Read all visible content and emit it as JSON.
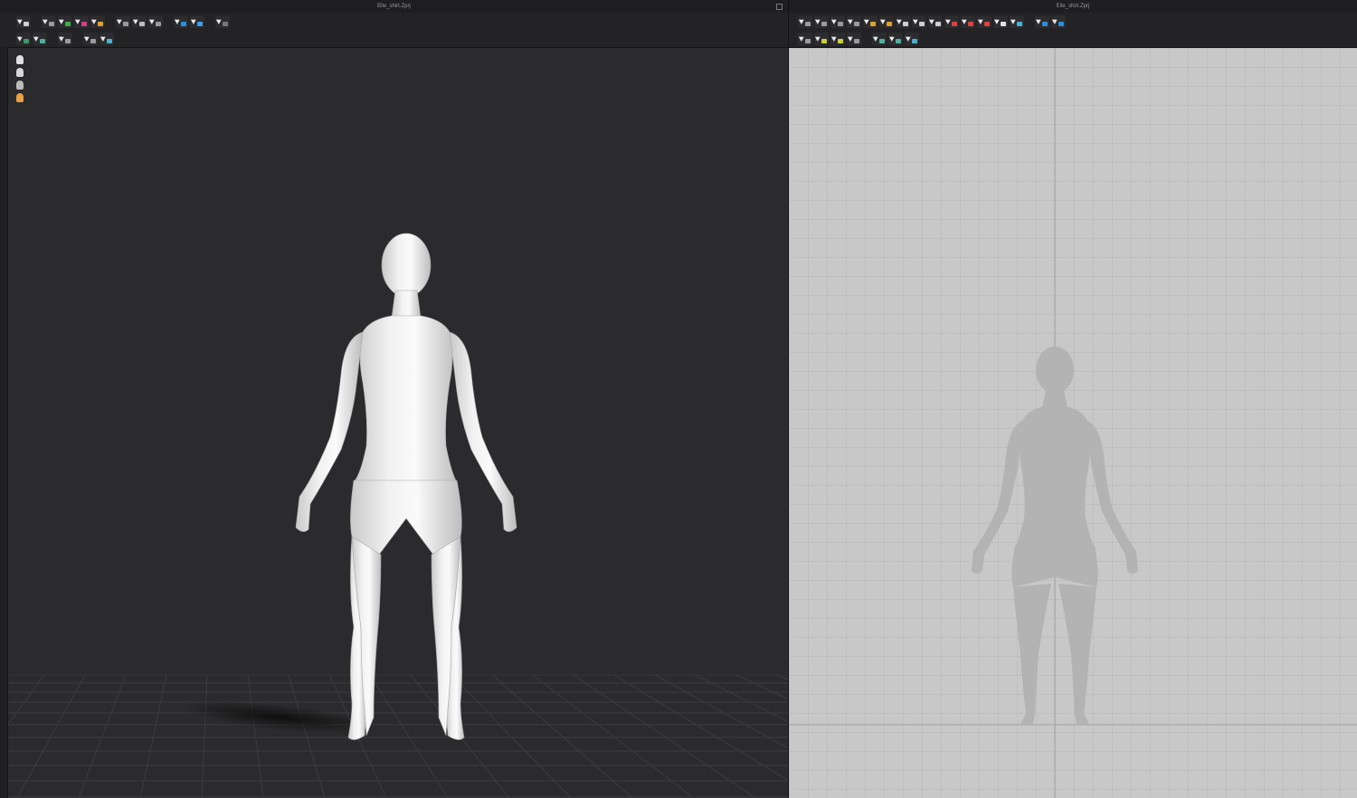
{
  "left_pane": {
    "title": "Elle_shirt.Zprj",
    "toolbar_row1": [
      {
        "icon": "arrow-down-icon",
        "color": "#cfcfcf"
      },
      {
        "icon": "select-tool-icon",
        "color": "#9a9a9a"
      },
      {
        "icon": "shirt-icon",
        "color": "#3fae4a"
      },
      {
        "icon": "shirt-icon",
        "color": "#d63a8a"
      },
      {
        "icon": "folder-icon",
        "color": "#e0a030"
      },
      {
        "icon": "pin-tool-icon",
        "color": "#9a9a9a"
      },
      {
        "icon": "fold-tool-icon",
        "color": "#bdbdbd"
      },
      {
        "icon": "avatar-tool-icon",
        "color": "#9a9a9a"
      },
      {
        "icon": "garment-blue-icon",
        "color": "#2a8de0"
      },
      {
        "icon": "garment-blue-icon",
        "color": "#3aa0f0"
      },
      {
        "icon": "ruler-icon",
        "color": "#777777"
      }
    ],
    "toolbar_row2": [
      {
        "icon": "select-mesh-icon",
        "color": "#3c9a6a"
      },
      {
        "icon": "texture-icon",
        "color": "#4ab0a0"
      },
      {
        "icon": "transform-icon",
        "color": "#9a9a9a"
      },
      {
        "icon": "edit-texture-icon",
        "color": "#9a9a9a"
      },
      {
        "icon": "graphic-icon",
        "color": "#4ab0d0"
      }
    ],
    "view_tools": [
      {
        "icon": "avatar-display-icon",
        "color": "#e0e0e0"
      },
      {
        "icon": "avatar-skin-icon",
        "color": "#d8d8d8"
      },
      {
        "icon": "garment-display-icon",
        "color": "#bcbcbc"
      },
      {
        "icon": "avatar-head-icon",
        "color": "#e8a040"
      }
    ]
  },
  "right_pane": {
    "title": "Elle_shirt.Zprj",
    "toolbar_row1": [
      {
        "icon": "transform-pattern-icon",
        "color": "#9a9a9a"
      },
      {
        "icon": "edit-pattern-icon",
        "color": "#9a9a9a"
      },
      {
        "icon": "edit-curvature-icon",
        "color": "#9a9a9a"
      },
      {
        "icon": "edit-point-icon",
        "color": "#9a9a9a"
      },
      {
        "icon": "add-point-icon",
        "color": "#e0a030"
      },
      {
        "icon": "segment-icon",
        "color": "#e0a030"
      },
      {
        "icon": "polygon-icon",
        "color": "#cfcfcf"
      },
      {
        "icon": "rectangle-icon",
        "color": "#cfcfcf"
      },
      {
        "icon": "circle-icon",
        "color": "#cfcfcf"
      },
      {
        "icon": "internal-polygon-icon",
        "color": "#e04040"
      },
      {
        "icon": "internal-rect-icon",
        "color": "#e04040"
      },
      {
        "icon": "internal-circle-icon",
        "color": "#e04040"
      },
      {
        "icon": "darts-icon",
        "color": "#e0e0e0"
      },
      {
        "icon": "trace-icon",
        "color": "#4ab0d0"
      },
      {
        "icon": "segment-sewing-icon",
        "color": "#2a8de0"
      },
      {
        "icon": "free-sewing-icon",
        "color": "#2a8de0"
      }
    ],
    "toolbar_row2": [
      {
        "icon": "edit-texture-2d-icon",
        "color": "#9a9a9a"
      },
      {
        "icon": "fold-arrangement-icon",
        "color": "#c8d040"
      },
      {
        "icon": "topstitch-icon",
        "color": "#c8d040"
      },
      {
        "icon": "measure-icon",
        "color": "#9a9a9a"
      },
      {
        "icon": "graphic-2d-icon",
        "color": "#4ab0a0"
      },
      {
        "icon": "texture-2d-icon",
        "color": "#4ab0a0"
      },
      {
        "icon": "annotation-icon",
        "color": "#4ab0d0"
      }
    ]
  }
}
